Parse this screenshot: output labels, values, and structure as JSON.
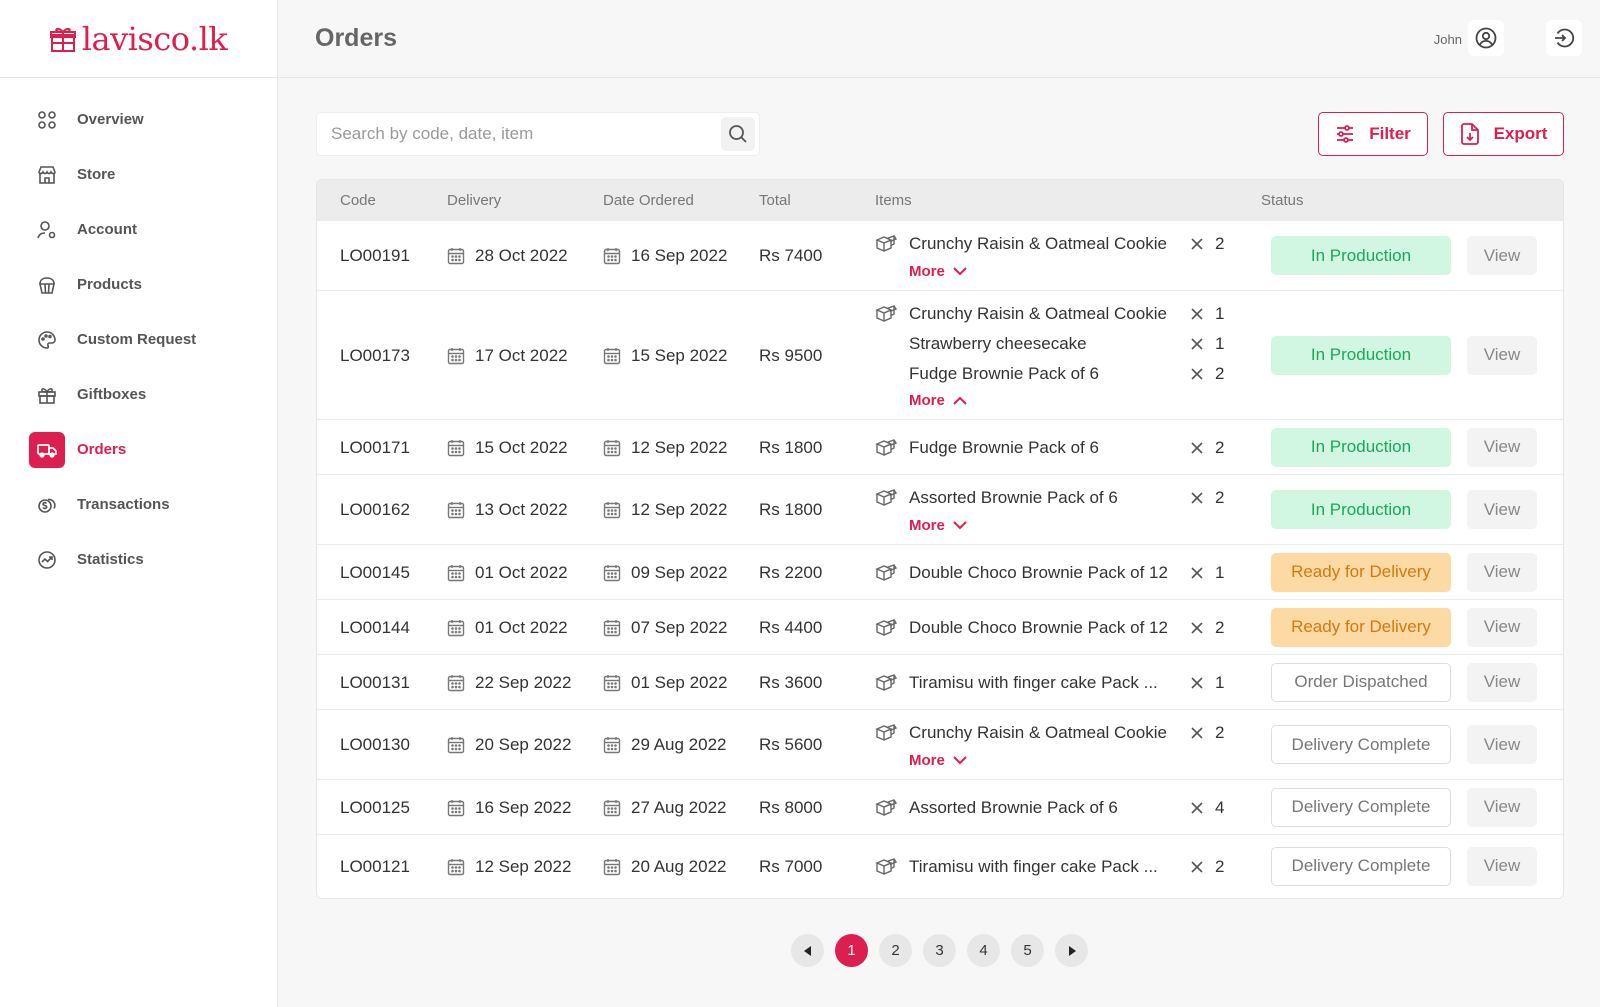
{
  "brand": {
    "logo_text": "lavisco.lk",
    "accent": "#dc1f4e"
  },
  "header": {
    "title": "Orders",
    "user_name": "John"
  },
  "sidebar": {
    "items": [
      {
        "label": "Overview",
        "icon": "grid-icon"
      },
      {
        "label": "Store",
        "icon": "store-icon"
      },
      {
        "label": "Account",
        "icon": "user-settings-icon"
      },
      {
        "label": "Products",
        "icon": "cupcake-icon"
      },
      {
        "label": "Custom Request",
        "icon": "palette-icon"
      },
      {
        "label": "Giftboxes",
        "icon": "gift-icon"
      },
      {
        "label": "Orders",
        "icon": "truck-icon",
        "active": true
      },
      {
        "label": "Transactions",
        "icon": "coins-icon"
      },
      {
        "label": "Statistics",
        "icon": "chart-icon"
      }
    ]
  },
  "toolbar": {
    "search_placeholder": "Search by code, date, item",
    "filter_label": "Filter",
    "export_label": "Export"
  },
  "table": {
    "columns": [
      "Code",
      "Delivery",
      "Date Ordered",
      "Total",
      "Items",
      "Status"
    ],
    "view_label": "View",
    "more_label": "More",
    "rows": [
      {
        "code": "LO00191",
        "delivery": "28 Oct 2022",
        "ordered": "16 Sep 2022",
        "total": "Rs 7400",
        "items": [
          {
            "name": "Crunchy Raisin & Oatmeal Cookie",
            "qty": "2"
          }
        ],
        "more": "collapsed",
        "status": "In Production",
        "status_type": "production"
      },
      {
        "code": "LO00173",
        "delivery": "17 Oct 2022",
        "ordered": "15 Sep 2022",
        "total": "Rs 9500",
        "items": [
          {
            "name": "Crunchy Raisin & Oatmeal Cookie",
            "qty": "1"
          },
          {
            "name": "Strawberry cheesecake",
            "qty": "1"
          },
          {
            "name": "Fudge Brownie Pack of 6",
            "qty": "2"
          }
        ],
        "more": "expanded",
        "status": "In Production",
        "status_type": "production"
      },
      {
        "code": "LO00171",
        "delivery": "15 Oct 2022",
        "ordered": "12 Sep 2022",
        "total": "Rs 1800",
        "items": [
          {
            "name": "Fudge Brownie Pack of 6",
            "qty": "2"
          }
        ],
        "more": "none",
        "status": "In Production",
        "status_type": "production"
      },
      {
        "code": "LO00162",
        "delivery": "13 Oct 2022",
        "ordered": "12 Sep 2022",
        "total": "Rs 1800",
        "items": [
          {
            "name": "Assorted Brownie Pack of 6",
            "qty": "2"
          }
        ],
        "more": "collapsed",
        "status": "In Production",
        "status_type": "production"
      },
      {
        "code": "LO00145",
        "delivery": "01 Oct 2022",
        "ordered": "09 Sep 2022",
        "total": "Rs 2200",
        "items": [
          {
            "name": "Double Choco Brownie Pack of 12",
            "qty": "1"
          }
        ],
        "more": "none",
        "status": "Ready for Delivery",
        "status_type": "ready"
      },
      {
        "code": "LO00144",
        "delivery": "01 Oct 2022",
        "ordered": "07 Sep 2022",
        "total": "Rs 4400",
        "items": [
          {
            "name": "Double Choco Brownie Pack of 12",
            "qty": "2"
          }
        ],
        "more": "none",
        "status": "Ready for Delivery",
        "status_type": "ready"
      },
      {
        "code": "LO00131",
        "delivery": "22 Sep 2022",
        "ordered": "01 Sep 2022",
        "total": "Rs 3600",
        "items": [
          {
            "name": "Tiramisu with finger cake Pack ...",
            "qty": "1"
          }
        ],
        "more": "none",
        "status": "Order Dispatched",
        "status_type": "plain"
      },
      {
        "code": "LO00130",
        "delivery": "20 Sep 2022",
        "ordered": "29 Aug 2022",
        "total": "Rs 5600",
        "items": [
          {
            "name": "Crunchy Raisin & Oatmeal Cookie",
            "qty": "2"
          }
        ],
        "more": "collapsed",
        "status": "Delivery Complete",
        "status_type": "plain"
      },
      {
        "code": "LO00125",
        "delivery": "16 Sep 2022",
        "ordered": "27 Aug 2022",
        "total": "Rs 8000",
        "items": [
          {
            "name": "Assorted Brownie Pack of 6",
            "qty": "4"
          }
        ],
        "more": "none",
        "status": "Delivery Complete",
        "status_type": "plain"
      },
      {
        "code": "LO00121",
        "delivery": "12 Sep 2022",
        "ordered": "20 Aug 2022",
        "total": "Rs 7000",
        "items": [
          {
            "name": "Tiramisu with finger cake Pack ...",
            "qty": "2"
          }
        ],
        "more": "none",
        "status": "Delivery Complete",
        "status_type": "plain"
      }
    ]
  },
  "pagination": {
    "pages": [
      "1",
      "2",
      "3",
      "4",
      "5"
    ],
    "current": "1"
  }
}
